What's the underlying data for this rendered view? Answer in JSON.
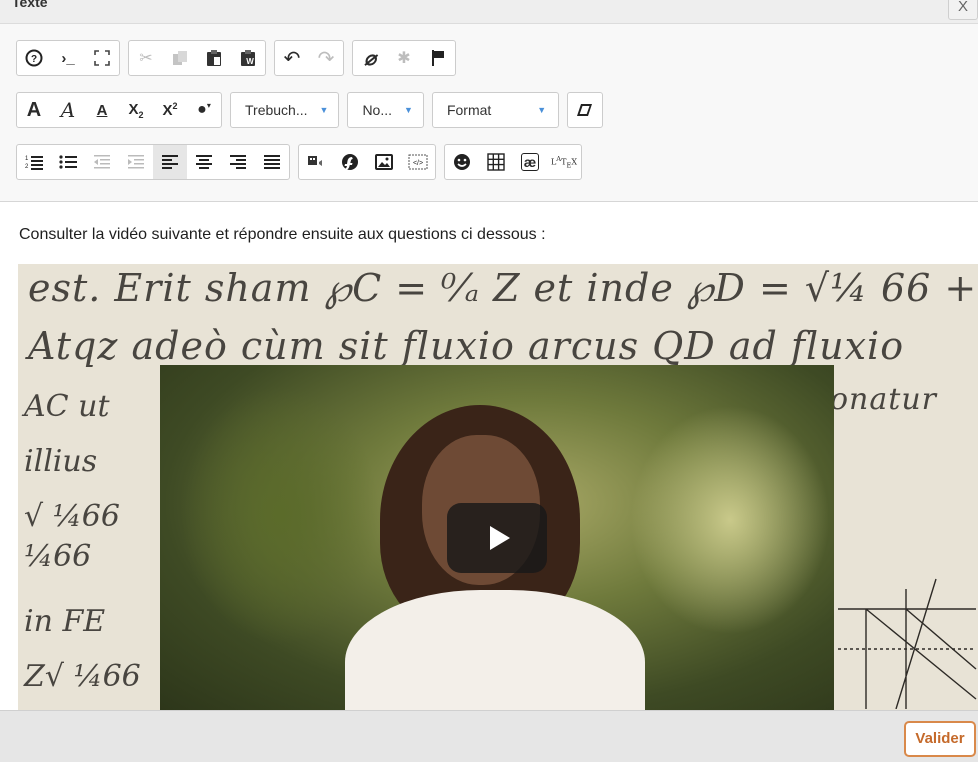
{
  "dialog": {
    "title": "Texte",
    "close_label": "X"
  },
  "toolbar": {
    "row1": [
      {
        "icon": "help-circle-icon",
        "glyph": "?"
      },
      {
        "icon": "source-code-icon",
        "glyph": ">_"
      },
      {
        "icon": "maximize-icon",
        "glyph": "⤢"
      },
      {
        "icon": "cut-icon",
        "glyph": "✂"
      },
      {
        "icon": "copy-icon",
        "glyph": "⎘"
      },
      {
        "icon": "paste-icon",
        "glyph": "📋"
      },
      {
        "icon": "paste-word-icon",
        "glyph": "W"
      },
      {
        "icon": "undo-icon",
        "glyph": "↶"
      },
      {
        "icon": "redo-icon",
        "glyph": "↷"
      },
      {
        "icon": "unlink-icon",
        "glyph": "⌀"
      },
      {
        "icon": "anchor-icon",
        "glyph": "✱"
      },
      {
        "icon": "flag-icon",
        "glyph": "⚑"
      }
    ],
    "row2": {
      "format_buttons": [
        {
          "icon": "bold-icon",
          "glyph": "A"
        },
        {
          "icon": "italic-icon",
          "glyph": "A"
        },
        {
          "icon": "underline-icon",
          "glyph": "A"
        },
        {
          "icon": "subscript-icon",
          "glyph": "X₂"
        },
        {
          "icon": "superscript-icon",
          "glyph": "X²"
        },
        {
          "icon": "text-color-icon",
          "glyph": "●"
        }
      ],
      "font_family": "Trebuch...",
      "font_size": "No...",
      "format": "Format"
    },
    "row3": [
      {
        "icon": "numbered-list-icon"
      },
      {
        "icon": "bulleted-list-icon"
      },
      {
        "icon": "outdent-icon"
      },
      {
        "icon": "indent-icon"
      },
      {
        "icon": "align-left-icon"
      },
      {
        "icon": "align-center-icon"
      },
      {
        "icon": "align-right-icon"
      },
      {
        "icon": "justify-icon"
      },
      {
        "icon": "media-icon"
      },
      {
        "icon": "flash-icon"
      },
      {
        "icon": "image-icon"
      },
      {
        "icon": "embed-icon"
      },
      {
        "icon": "smiley-icon"
      },
      {
        "icon": "table-icon"
      },
      {
        "icon": "special-char-icon",
        "glyph": "æ"
      },
      {
        "icon": "latex-icon",
        "glyph": "LaTeX"
      }
    ]
  },
  "content": {
    "instruction": "Consulter la vidéo suivante et répondre ensuite aux questions ci dessous :"
  },
  "footer": {
    "validate_label": "Valider"
  },
  "colors": {
    "validate_border": "#d9894a",
    "caret": "#4a90d9"
  }
}
